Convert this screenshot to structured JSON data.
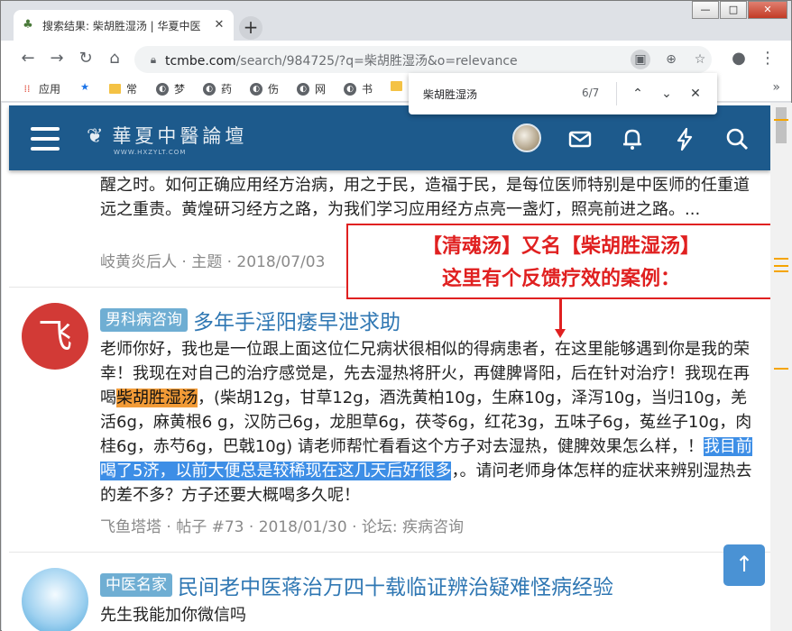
{
  "browser": {
    "tab_title": "搜索结果: 柴胡胜湿汤 | 华夏中医",
    "tab_close": "✕",
    "new_tab": "+",
    "url_host": "tcmbe.com",
    "url_path": "/search/984725/?q=柴胡胜湿汤&o=relevance",
    "window_buttons": {
      "minimize": "—",
      "maximize": "□",
      "close": "✕"
    }
  },
  "bookmarks": [
    {
      "label": "应用",
      "icon": "apps-icon"
    },
    {
      "label": "",
      "icon": "star-icon"
    },
    {
      "label": "常",
      "icon": "folder-icon"
    },
    {
      "label": "梦",
      "icon": "globe-icon"
    },
    {
      "label": "药",
      "icon": "globe-icon"
    },
    {
      "label": "伤",
      "icon": "globe-icon"
    },
    {
      "label": "网",
      "icon": "globe-icon"
    },
    {
      "label": "书",
      "icon": "globe-icon"
    }
  ],
  "find": {
    "query": "柴胡胜湿汤",
    "count": "6/7"
  },
  "site": {
    "logo_text": "華夏中醫論壇",
    "logo_sub": "WWW.HXZYLT.COM"
  },
  "prev_post": {
    "text": "醒之时。如何正确应用经方治病，用之于民，造福于民，是每位医师特别是中医师的任重道远之重责。黄煌研习经方之路，为我们学习应用经方点亮一盏灯，照亮前进之路。...",
    "meta": "岐黄炎后人 · 主题 · 2018/07/03"
  },
  "annotation": {
    "line1": "【清魂汤】又名【柴胡胜湿汤】",
    "line2": "这里有个反馈疗效的案例："
  },
  "post": {
    "avatar_letter": "飞",
    "tag": "男科病咨询",
    "title": "多年手淫阳痿早泄求助",
    "body_before": "老师你好，我也是一位跟上面这位仁兄病状很相似的得病患者，在这里能够遇到你是我的荣幸！我现在对自己的治疗感觉是，先去湿热将肝火，再健脾肾阳，后在针对治疗！我现在再喝",
    "body_hl": "柴胡胜湿汤",
    "body_mid": "，(柴胡12g，甘草12g，酒洗黄柏10g，生麻10g，泽泻10g，当归10g，羌活6g，麻黄根6 g，汉防己6g，龙胆草6g，茯苓6g，红花3g，五味子6g，菟丝子10g，肉桂6g，赤芍6g，巴戟10g) 请老师帮忙看看这个方子对去湿热，健脾效果怎么样，！",
    "body_sel": "我目前喝了5济，以前大便总是较稀现在这几天后好很多",
    "body_after": "，。请问老师身体怎样的症状来辨别湿热去的差不多？方子还要大概喝多久呢！",
    "meta": "飞鱼塔塔 · 帖子 #73 · 2018/01/30 · 论坛: 疾病咨询"
  },
  "next_post": {
    "tag": "中医名家",
    "title": "民间老中医蒋治万四十载临证辨治疑难怪病经验",
    "text": "先生我能加你微信吗"
  },
  "colors": {
    "nav_bg": "#1d5a8c",
    "tag_bg": "#6faed3",
    "title_link": "#2f77b3",
    "highlight_find": "#f29b37",
    "highlight_select": "#3d8ee6",
    "annotation": "#e02020"
  }
}
